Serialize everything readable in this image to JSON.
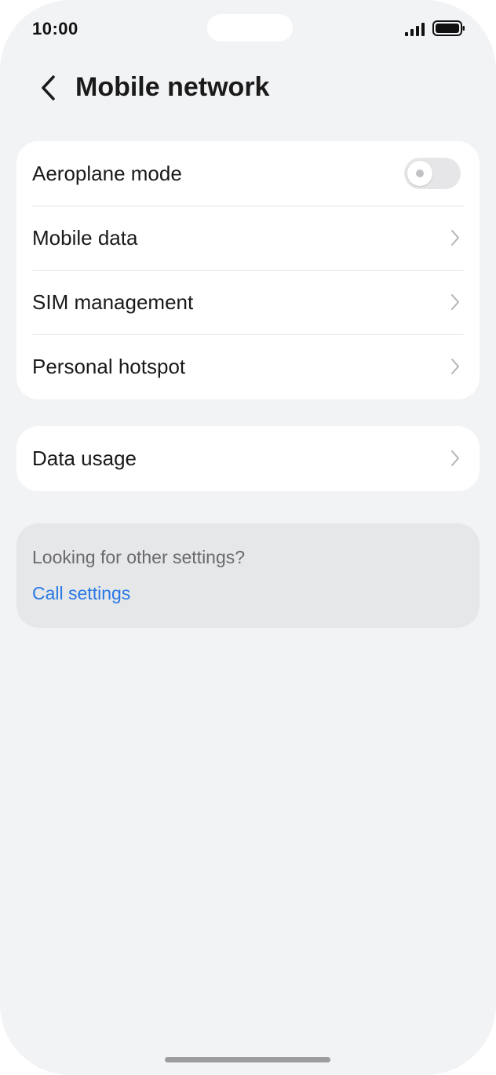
{
  "status_bar": {
    "time": "10:00",
    "signal_icon": "signal-bars-icon",
    "battery_icon": "battery-icon"
  },
  "header": {
    "title": "Mobile network",
    "back_icon": "chevron-left-icon"
  },
  "main_list": {
    "items": [
      {
        "label": "Aeroplane mode",
        "type": "toggle",
        "toggle_on": false
      },
      {
        "label": "Mobile data",
        "type": "link"
      },
      {
        "label": "SIM management",
        "type": "link"
      },
      {
        "label": "Personal hotspot",
        "type": "link"
      }
    ]
  },
  "usage_list": {
    "items": [
      {
        "label": "Data usage",
        "type": "link"
      }
    ]
  },
  "suggestions": {
    "prompt": "Looking for other settings?",
    "link": "Call settings"
  },
  "colors": {
    "background": "#f2f3f5",
    "card": "#ffffff",
    "link": "#2878e6",
    "toggle_off": "#e6e6e8"
  }
}
